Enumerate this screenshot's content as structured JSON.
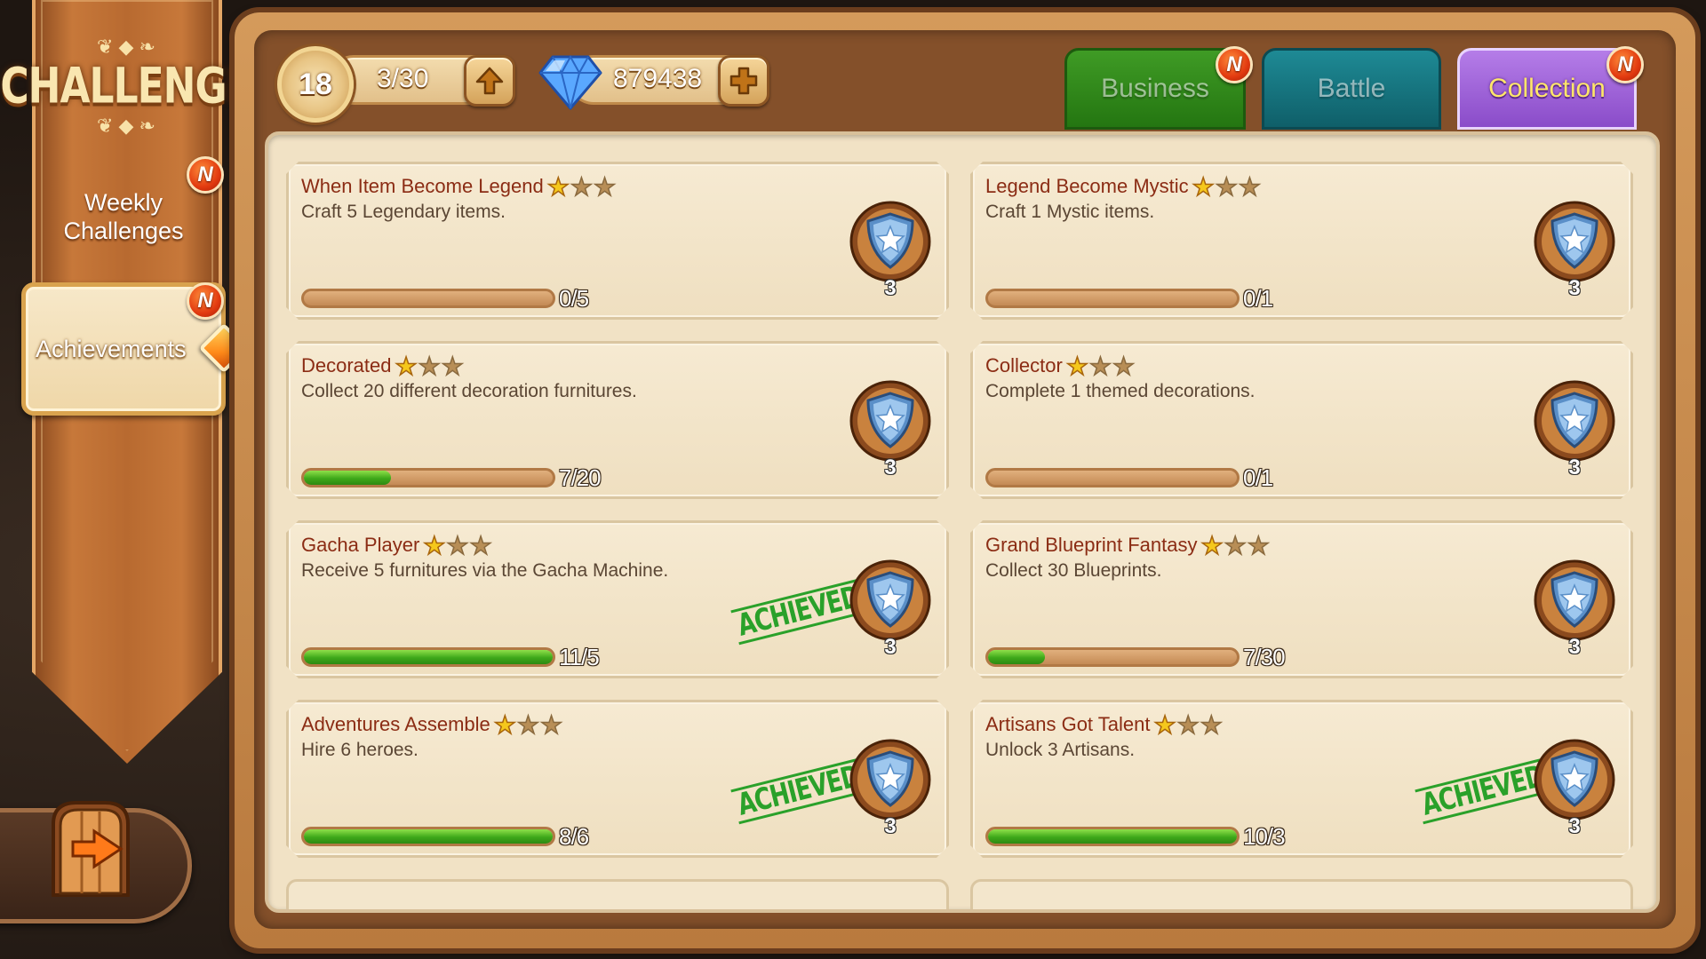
{
  "sidebar": {
    "logo_text": "CHALLENGE",
    "weekly_label": "Weekly Challenges",
    "weekly_badge": "N",
    "achievements_label": "Achievements",
    "achievements_badge": "N"
  },
  "header": {
    "level": "18",
    "energy": "3/30",
    "gems": "879438"
  },
  "tabs": [
    {
      "label": "Business",
      "badge": "N",
      "active": false
    },
    {
      "label": "Battle",
      "badge": "",
      "active": false
    },
    {
      "label": "Collection",
      "badge": "N",
      "active": true
    }
  ],
  "achievements": [
    {
      "title": "When Item Become Legend",
      "desc": "Craft 5 Legendary items.",
      "progress": "0/5",
      "fill": 0.0,
      "stars": 1,
      "reward": "3",
      "achieved": false,
      "achieved_label": ""
    },
    {
      "title": "Legend Become Mystic",
      "desc": "Craft 1 Mystic items.",
      "progress": "0/1",
      "fill": 0.0,
      "stars": 1,
      "reward": "3",
      "achieved": false,
      "achieved_label": ""
    },
    {
      "title": "Decorated",
      "desc": "Collect 20 different decoration furnitures.",
      "progress": "7/20",
      "fill": 0.35,
      "stars": 1,
      "reward": "3",
      "achieved": false,
      "achieved_label": ""
    },
    {
      "title": "Collector",
      "desc": "Complete 1 themed decorations.",
      "progress": "0/1",
      "fill": 0.0,
      "stars": 1,
      "reward": "3",
      "achieved": false,
      "achieved_label": ""
    },
    {
      "title": "Gacha Player",
      "desc": "Receive 5 furnitures via the Gacha Machine.",
      "progress": "11/5",
      "fill": 1.0,
      "stars": 1,
      "reward": "3",
      "achieved": true,
      "achieved_label": "ACHIEVED"
    },
    {
      "title": "Grand Blueprint Fantasy",
      "desc": "Collect 30 Blueprints.",
      "progress": "7/30",
      "fill": 0.23,
      "stars": 1,
      "reward": "3",
      "achieved": false,
      "achieved_label": ""
    },
    {
      "title": "Adventures Assemble",
      "desc": "Hire 6 heroes.",
      "progress": "8/6",
      "fill": 1.0,
      "stars": 1,
      "reward": "3",
      "achieved": true,
      "achieved_label": "ACHIEVED"
    },
    {
      "title": "Artisans Got Talent",
      "desc": "Unlock 3 Artisans.",
      "progress": "10/3",
      "fill": 1.0,
      "stars": 1,
      "reward": "3",
      "achieved": true,
      "achieved_label": "ACHIEVED"
    }
  ],
  "colors": {
    "title_text": "#8b2c14",
    "progress_green": "#3ea81a",
    "achieved_stamp": "#2aa12a",
    "collection_tab": "#8a4cc9",
    "business_tab": "#247611",
    "battle_tab": "#0f5f69"
  },
  "icons": {
    "level": "level-coin-icon",
    "upgrade": "arrow-up-icon",
    "gem": "diamond-icon",
    "add": "plus-icon",
    "reward": "shield-star-icon",
    "back": "exit-door-icon"
  }
}
